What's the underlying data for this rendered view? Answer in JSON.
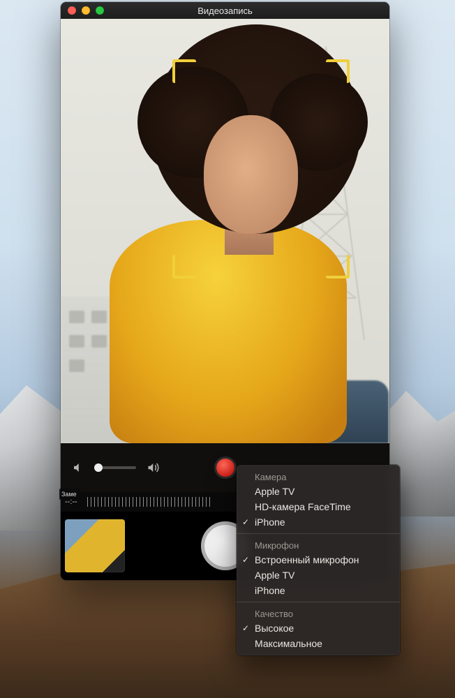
{
  "window": {
    "title": "Видеозапись",
    "status": {
      "time": "--:--",
      "tag": "Заме"
    }
  },
  "controls": {
    "volume_low_icon": "volume-low-icon",
    "volume_high_icon": "volume-high-icon",
    "record_icon": "record-icon",
    "options_chevron_icon": "chevron-down-icon",
    "shutter_icon": "shutter-icon"
  },
  "menu": {
    "sections": [
      {
        "label": "Камера",
        "items": [
          {
            "label": "Apple TV",
            "checked": false
          },
          {
            "label": "HD-камера FaceTime",
            "checked": false
          },
          {
            "label": "iPhone",
            "checked": true
          }
        ]
      },
      {
        "label": "Микрофон",
        "items": [
          {
            "label": "Встроенный микрофон",
            "checked": true
          },
          {
            "label": "Apple TV",
            "checked": false
          },
          {
            "label": "iPhone",
            "checked": false
          }
        ]
      },
      {
        "label": "Качество",
        "items": [
          {
            "label": "Высокое",
            "checked": true
          },
          {
            "label": "Максимальное",
            "checked": false
          }
        ]
      }
    ]
  },
  "colors": {
    "accent_focus": "#f0cf3a",
    "record_red": "#d6221a"
  }
}
